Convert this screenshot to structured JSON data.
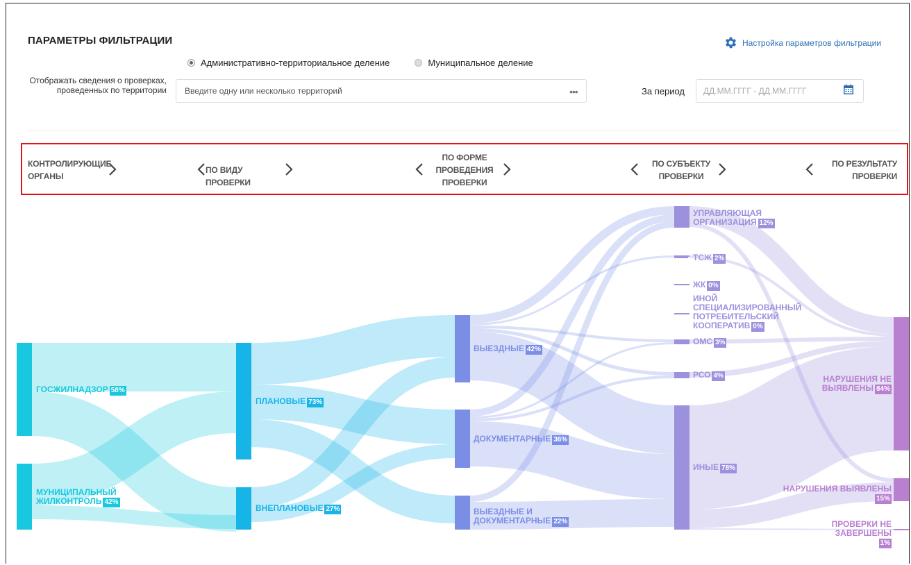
{
  "filters": {
    "title": "ПАРАМЕТРЫ ФИЛЬТРАЦИИ",
    "settings_link": "Настройка параметров фильтрации",
    "radio_options": [
      {
        "label": "Административно-территориальное деление",
        "selected": true
      },
      {
        "label": "Муниципальное деление",
        "selected": false
      }
    ],
    "territory_label": "Отображать сведения о проверках, проведенных по территории",
    "territory_placeholder": "Введите одну или несколько территорий",
    "dots_button": "•••",
    "period_label": "За период",
    "period_placeholder": "ДД.ММ.ГГГГ - ДД.ММ.ГГГГ"
  },
  "steps": [
    {
      "label": "КОНТРОЛИРУЮЩИЕ ОРГАНЫ"
    },
    {
      "label": "ПО ВИДУ ПРОВЕРКИ"
    },
    {
      "label": "ПО ФОРМЕ ПРОВЕДЕНИЯ ПРОВЕРКИ"
    },
    {
      "label": "ПО СУБЪЕКТУ ПРОВЕРКИ"
    },
    {
      "label": "ПО РЕЗУЛЬТАТУ ПРОВЕРКИ"
    }
  ],
  "colors": {
    "accent_link": "#2d6fb6",
    "highlight_border": "#e0151b",
    "col1": "#17c8de",
    "col2": "#17b4e8",
    "col3": "#7a8ee6",
    "col4": "#9b91dd",
    "col5": "#b97fd0"
  },
  "sankey": {
    "nodes": [
      {
        "id": "gos",
        "col": 0,
        "label": "ГОСЖИЛНАДЗОР",
        "pct": "58%"
      },
      {
        "id": "mun",
        "col": 0,
        "label": "МУНИЦИПАЛЬНЫЙ ЖИЛКОНТРОЛЬ",
        "pct": "42%"
      },
      {
        "id": "plan",
        "col": 1,
        "label": "ПЛАНОВЫЕ",
        "pct": "73%"
      },
      {
        "id": "vnepl",
        "col": 1,
        "label": "ВНЕПЛАНОВЫЕ",
        "pct": "27%"
      },
      {
        "id": "vyezd",
        "col": 2,
        "label": "ВЫЕЗДНЫЕ",
        "pct": "42%"
      },
      {
        "id": "dok",
        "col": 2,
        "label": "ДОКУМЕНТАРНЫЕ",
        "pct": "36%"
      },
      {
        "id": "vyezddok",
        "col": 2,
        "label": "ВЫЕЗДНЫЕ И ДОКУМЕНТАРНЫЕ",
        "pct": "22%"
      },
      {
        "id": "uo",
        "col": 3,
        "label": "УПРАВЛЯЮЩАЯ ОРГАНИЗАЦИЯ",
        "pct": "12%"
      },
      {
        "id": "tszh",
        "col": 3,
        "label": "ТСЖ",
        "pct": "2%"
      },
      {
        "id": "zhk",
        "col": 3,
        "label": "ЖК",
        "pct": "0%"
      },
      {
        "id": "isk",
        "col": 3,
        "label": "ИНОЙ СПЕЦИАЛИЗИРОВАННЫЙ ПОТРЕБИТЕЛЬСКИЙ КООПЕРАТИВ",
        "pct": "0%"
      },
      {
        "id": "oms",
        "col": 3,
        "label": "ОМС",
        "pct": "3%"
      },
      {
        "id": "rso",
        "col": 3,
        "label": "РСО",
        "pct": "4%"
      },
      {
        "id": "inye",
        "col": 3,
        "label": "ИНЫЕ",
        "pct": "78%"
      },
      {
        "id": "ne_vyyav",
        "col": 4,
        "label": "НАРУШЕНИЯ НЕ ВЫЯВЛЕНЫ",
        "pct": "84%"
      },
      {
        "id": "vyyav",
        "col": 4,
        "label": "НАРУШЕНИЯ ВЫЯВЛЕНЫ",
        "pct": "15%"
      },
      {
        "id": "nezav",
        "col": 4,
        "label": "ПРОВЕРКИ НЕ ЗАВЕРШЕНЫ",
        "pct": "1%"
      }
    ]
  }
}
